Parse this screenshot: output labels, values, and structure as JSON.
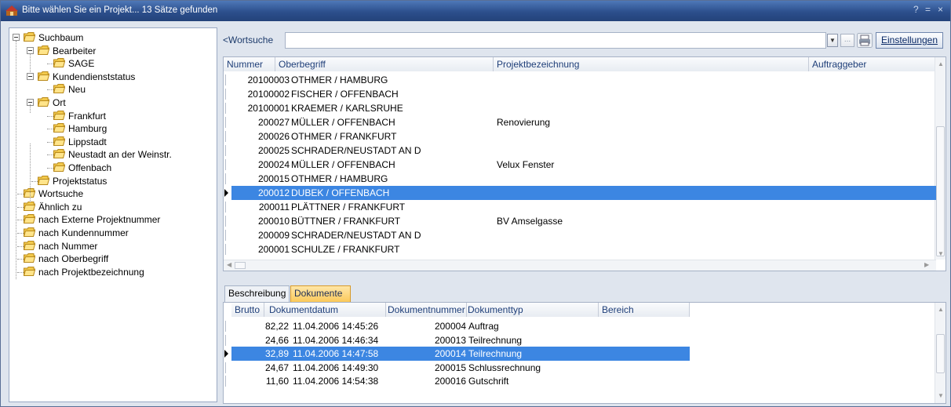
{
  "window": {
    "title": "Bitte wählen Sie ein Projekt... 13 Sätze gefunden",
    "controls": [
      "?",
      "=",
      "×"
    ]
  },
  "tree": {
    "items": [
      {
        "label": "Suchbaum",
        "level": 0,
        "expanded": true
      },
      {
        "label": "Bearbeiter",
        "level": 1,
        "expanded": true
      },
      {
        "label": "SAGE",
        "level": 2
      },
      {
        "label": "Kundendienststatus",
        "level": 1,
        "expanded": true
      },
      {
        "label": "Neu",
        "level": 2
      },
      {
        "label": "Ort",
        "level": 1,
        "expanded": true
      },
      {
        "label": "Frankfurt",
        "level": 2
      },
      {
        "label": "Hamburg",
        "level": 2
      },
      {
        "label": "Lippstadt",
        "level": 2
      },
      {
        "label": "Neustadt an der Weinstr.",
        "level": 2
      },
      {
        "label": "Offenbach",
        "level": 2
      },
      {
        "label": "Projektstatus",
        "level": 1
      },
      {
        "label": "Wortsuche",
        "level": 0
      },
      {
        "label": "Ähnlich zu",
        "level": 0
      },
      {
        "label": "nach Externe Projektnummer",
        "level": 0
      },
      {
        "label": "nach Kundennummer",
        "level": 0
      },
      {
        "label": "nach Nummer",
        "level": 0
      },
      {
        "label": "nach Oberbegriff",
        "level": 0
      },
      {
        "label": "nach Projektbezeichnung",
        "level": 0
      }
    ]
  },
  "search": {
    "label": "<Wortsuche",
    "value": "",
    "dropdown_icon": "chevron-down-icon",
    "ellipsis": "...",
    "settings_label": "Einstellungen"
  },
  "projects": {
    "columns": [
      "Nummer",
      "Oberbegriff",
      "Projektbezeichnung",
      "Auftraggeber"
    ],
    "rows": [
      {
        "nummer": "20100003",
        "oberbegriff": "OTHMER / HAMBURG",
        "bezeichnung": "",
        "auftraggeber": ""
      },
      {
        "nummer": "20100002",
        "oberbegriff": "FISCHER / OFFENBACH",
        "bezeichnung": "",
        "auftraggeber": ""
      },
      {
        "nummer": "20100001",
        "oberbegriff": "KRAEMER / KARLSRUHE",
        "bezeichnung": "",
        "auftraggeber": ""
      },
      {
        "nummer": "200027",
        "oberbegriff": "MÜLLER / OFFENBACH",
        "bezeichnung": "Renovierung",
        "auftraggeber": ""
      },
      {
        "nummer": "200026",
        "oberbegriff": "OTHMER / FRANKFURT",
        "bezeichnung": "",
        "auftraggeber": ""
      },
      {
        "nummer": "200025",
        "oberbegriff": "SCHRADER/NEUSTADT AN D",
        "bezeichnung": "",
        "auftraggeber": ""
      },
      {
        "nummer": "200024",
        "oberbegriff": "MÜLLER / OFFENBACH",
        "bezeichnung": "Velux Fenster",
        "auftraggeber": ""
      },
      {
        "nummer": "200015",
        "oberbegriff": "OTHMER / HAMBURG",
        "bezeichnung": "",
        "auftraggeber": ""
      },
      {
        "nummer": "200012",
        "oberbegriff": "DUBEK / OFFENBACH",
        "bezeichnung": "",
        "auftraggeber": "",
        "selected": true
      },
      {
        "nummer": "200011",
        "oberbegriff": "PLÄTTNER / FRANKFURT",
        "bezeichnung": "",
        "auftraggeber": ""
      },
      {
        "nummer": "200010",
        "oberbegriff": "BÜTTNER / FRANKFURT",
        "bezeichnung": "BV Amselgasse",
        "auftraggeber": ""
      },
      {
        "nummer": "200009",
        "oberbegriff": "SCHRADER/NEUSTADT AN D",
        "bezeichnung": "",
        "auftraggeber": ""
      },
      {
        "nummer": "200001",
        "oberbegriff": "SCHULZE / FRANKFURT",
        "bezeichnung": "",
        "auftraggeber": ""
      }
    ]
  },
  "tabs": [
    {
      "label": "Beschreibung",
      "active": false
    },
    {
      "label": "Dokumente",
      "active": true
    }
  ],
  "documents": {
    "columns": [
      "Brutto",
      "Dokumentdatum",
      "Dokumentnummer",
      "Dokumenttyp",
      "Bereich"
    ],
    "rows": [
      {
        "brutto": "82,22",
        "datum": "11.04.2006 14:45:26",
        "nummer": "200004",
        "typ": "Auftrag",
        "bereich": ""
      },
      {
        "brutto": "24,66",
        "datum": "11.04.2006 14:46:34",
        "nummer": "200013",
        "typ": "Teilrechnung",
        "bereich": ""
      },
      {
        "brutto": "32,89",
        "datum": "11.04.2006 14:47:58",
        "nummer": "200014",
        "typ": "Teilrechnung",
        "bereich": "",
        "selected": true
      },
      {
        "brutto": "24,67",
        "datum": "11.04.2006 14:49:30",
        "nummer": "200015",
        "typ": "Schlussrechnung",
        "bereich": ""
      },
      {
        "brutto": "11,60",
        "datum": "11.04.2006 14:54:38",
        "nummer": "200016",
        "typ": "Gutschrift",
        "bereich": ""
      }
    ]
  },
  "colors": {
    "titlebar": "#2c4f8c",
    "selection": "#3c86e2",
    "active_tab": "#fbc95a",
    "folder": "#f2c94c"
  }
}
